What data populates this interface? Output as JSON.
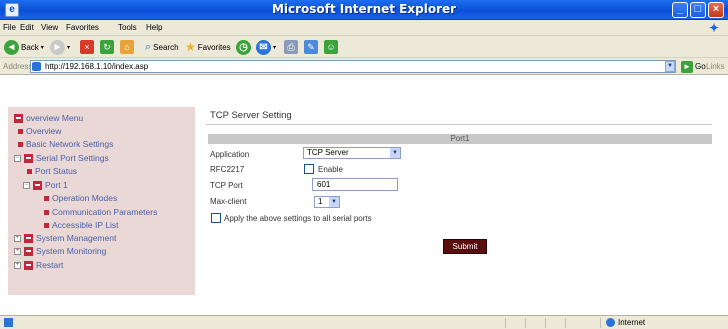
{
  "window": {
    "title": "Microsoft Internet Explorer"
  },
  "menubar": {
    "items": [
      "File",
      "Edit",
      "View",
      "Favorites",
      "Tools",
      "Help"
    ]
  },
  "toolbar": {
    "back_label": "Back",
    "search_label": "Search",
    "favorites_label": "Favorites"
  },
  "addressbar": {
    "label": "Address",
    "url": "http://192.168.1.10/index.asp",
    "go_label": "Go",
    "links_label": "Links"
  },
  "sidebar": {
    "items": [
      {
        "label": "overview Menu"
      },
      {
        "label": "Overview"
      },
      {
        "label": "Basic Network Settings"
      },
      {
        "label": "Serial Port Settings"
      },
      {
        "label": "Port Status"
      },
      {
        "label": "Port 1"
      },
      {
        "label": "Operation Modes"
      },
      {
        "label": "Communication Parameters"
      },
      {
        "label": "Accessible IP List"
      },
      {
        "label": "System Management"
      },
      {
        "label": "System Monitoring"
      },
      {
        "label": "Restart"
      }
    ]
  },
  "main": {
    "title": "TCP Server Setting",
    "port_header": "Port1",
    "application_label": "Application",
    "application_value": "TCP Server",
    "rfc_label": "RFC2217",
    "rfc_enable_label": "Enable",
    "tcp_port_label": "TCP Port",
    "tcp_port_value": "601",
    "max_client_label": "Max-client",
    "max_client_value": "1",
    "apply_all_label": "Apply the above settings to all serial ports",
    "submit_label": "Submit"
  },
  "statusbar": {
    "zone_label": "Internet"
  },
  "colors": {
    "sidebar_bg": "#e9d8d6",
    "link_text": "#4a5ea8",
    "icon_red": "#c0283c",
    "submit_bg": "#5a0d0d",
    "title_blue": "#0a4fd6"
  }
}
